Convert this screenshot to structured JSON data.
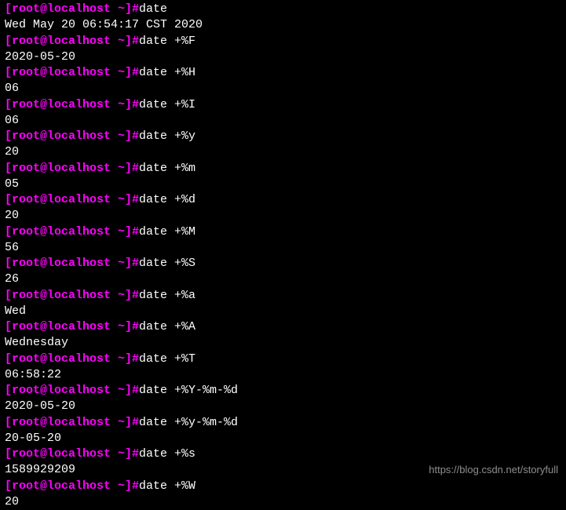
{
  "prompt": "[root@localhost ~]#",
  "watermark": "https://blog.csdn.net/storyfull",
  "entries": [
    {
      "cmd": "date",
      "out": "Wed May 20 06:54:17 CST 2020"
    },
    {
      "cmd": "date +%F",
      "out": "2020-05-20"
    },
    {
      "cmd": "date +%H",
      "out": "06"
    },
    {
      "cmd": "date +%I",
      "out": "06"
    },
    {
      "cmd": "date +%y",
      "out": "20"
    },
    {
      "cmd": "date +%m",
      "out": "05"
    },
    {
      "cmd": "date +%d",
      "out": "20"
    },
    {
      "cmd": "date +%M",
      "out": "56"
    },
    {
      "cmd": "date +%S",
      "out": "26"
    },
    {
      "cmd": "date +%a",
      "out": "Wed"
    },
    {
      "cmd": "date +%A",
      "out": "Wednesday"
    },
    {
      "cmd": "date +%T",
      "out": "06:58:22"
    },
    {
      "cmd": "date +%Y-%m-%d",
      "out": "2020-05-20"
    },
    {
      "cmd": "date +%y-%m-%d",
      "out": "20-05-20"
    },
    {
      "cmd": "date +%s",
      "out": "1589929209"
    },
    {
      "cmd": "date +%W",
      "out": "20"
    }
  ]
}
